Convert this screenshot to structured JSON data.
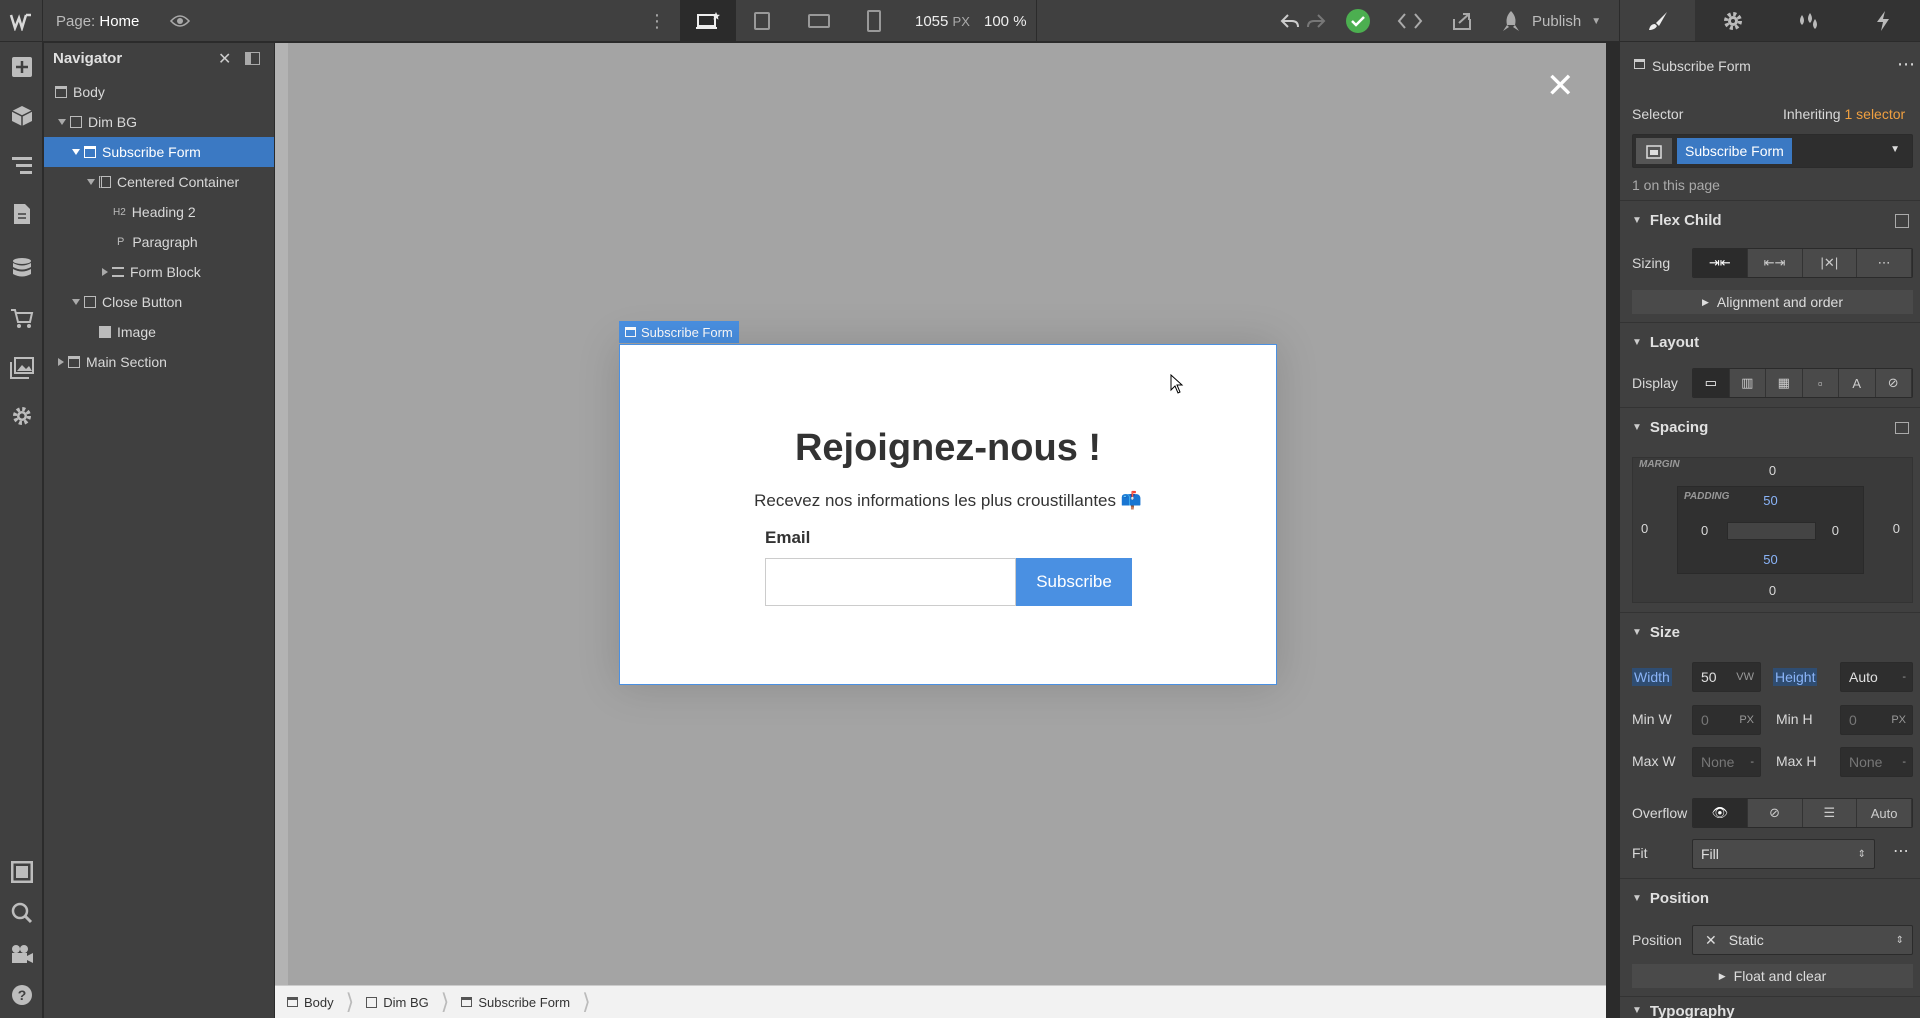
{
  "topbar": {
    "page_label": "Page:",
    "page_name": "Home",
    "width_value": "1055",
    "width_unit": "PX",
    "zoom": "100 %",
    "publish_label": "Publish"
  },
  "tools": {
    "logo": "webflow-logo",
    "icons": [
      "add-icon",
      "components-icon",
      "navigator-icon",
      "pages-icon",
      "cms-icon",
      "ecommerce-icon",
      "assets-icon",
      "settings-icon",
      "preview-toggle-icon",
      "search-icon",
      "video-icon",
      "help-icon"
    ]
  },
  "navigator": {
    "title": "Navigator",
    "items": [
      {
        "label": "Body"
      },
      {
        "label": "Dim BG"
      },
      {
        "label": "Subscribe Form"
      },
      {
        "label": "Centered Container"
      },
      {
        "label": "Heading 2"
      },
      {
        "label": "Paragraph"
      },
      {
        "label": "Form Block"
      },
      {
        "label": "Close Button"
      },
      {
        "label": "Image"
      },
      {
        "label": "Main Section"
      }
    ]
  },
  "canvas": {
    "element_tag": "Subscribe Form",
    "close_glyph": "✕"
  },
  "modal": {
    "heading": "Rejoignez-nous !",
    "paragraph": "Recevez nos informations les plus croustillantes 📫",
    "email_label": "Email",
    "email_value": "",
    "button_label": "Subscribe"
  },
  "breadcrumb": {
    "items": [
      "Body",
      "Dim BG",
      "Subscribe Form"
    ]
  },
  "right": {
    "element_name": "Subscribe Form",
    "selector_label": "Selector",
    "inheriting_label": "Inheriting",
    "inheriting_link": "1 selector",
    "selector_chip": "Subscribe Form",
    "on_page": "1 on this page",
    "flex_child": {
      "title": "Flex Child",
      "sizing_label": "Sizing",
      "align_order": "Alignment and order"
    },
    "layout": {
      "title": "Layout",
      "display_label": "Display"
    },
    "spacing": {
      "title": "Spacing",
      "margin_label": "MARGIN",
      "padding_label": "PADDING",
      "margin_top": "0",
      "margin_right": "0",
      "margin_bottom": "0",
      "margin_left": "0",
      "padding_top": "50",
      "padding_right": "0",
      "padding_bottom": "50",
      "padding_left": "0"
    },
    "size": {
      "title": "Size",
      "width_label": "Width",
      "width_value": "50",
      "width_unit": "VW",
      "height_label": "Height",
      "height_value": "Auto",
      "height_unit": "-",
      "minw_label": "Min W",
      "minw_value": "0",
      "minw_unit": "PX",
      "minh_label": "Min H",
      "minh_value": "0",
      "minh_unit": "PX",
      "maxw_label": "Max W",
      "maxw_value": "None",
      "maxw_unit": "-",
      "maxh_label": "Max H",
      "maxh_value": "None",
      "maxh_unit": "-",
      "overflow_label": "Overflow",
      "overflow_auto": "Auto",
      "fit_label": "Fit",
      "fit_value": "Fill"
    },
    "position": {
      "title": "Position",
      "position_label": "Position",
      "position_value": "Static",
      "float_clear": "Float and clear"
    },
    "typography": {
      "title": "Typography"
    }
  },
  "colors": {
    "accent": "#3b79c3",
    "button": "#4a90e2",
    "success": "#4caf50",
    "link": "#f0a040"
  }
}
